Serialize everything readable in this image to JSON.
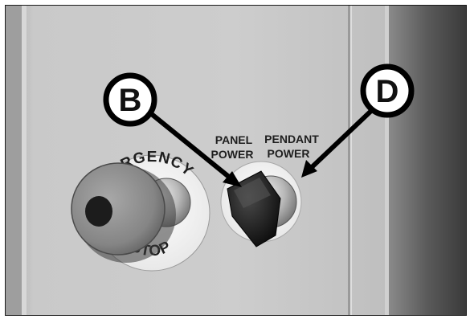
{
  "emergency_stop": {
    "ring_top": "EMERGENCY",
    "ring_bottom": "STOP",
    "ring_top_visible": "ERGENCY"
  },
  "selector_labels": {
    "panel_line1": "PANEL",
    "panel_line2": "POWER",
    "pendant_line1": "PENDANT",
    "pendant_line2": "POWER"
  },
  "callouts": {
    "left_letter": "B",
    "right_letter": "D"
  },
  "colors": {
    "panel": "#c4c4c4",
    "stop_button": "#8f8f8f",
    "knob": "#1a1a1a",
    "callout_fill": "#ffffff",
    "callout_ring": "#000000"
  }
}
